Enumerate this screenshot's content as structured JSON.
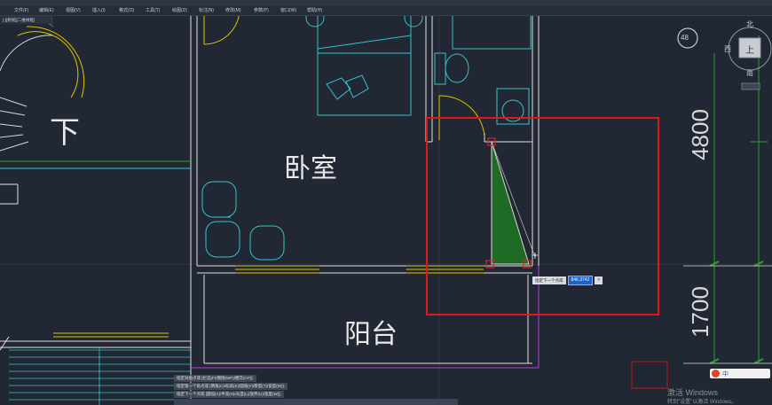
{
  "menu": [
    "文件(F)",
    "编辑(E)",
    "视图(V)",
    "插入(I)",
    "格式(O)",
    "工具(T)",
    "绘图(D)",
    "标注(N)",
    "修改(M)",
    "参数(P)",
    "窗口(W)",
    "帮助(H)"
  ],
  "tab": "[-][俯视][二维线框]",
  "rooms": {
    "stairs": "下",
    "bedroom": "卧室",
    "balcony": "阳台"
  },
  "dimensions": {
    "upper": "4800",
    "lower": "1700"
  },
  "compass": {
    "scale": "48",
    "north": "北",
    "west": "西",
    "south": "南",
    "center": "上"
  },
  "command_history": [
    "指定对角点或 [栏选(F)/圈围(WP)/圈交(CP)]:",
    "指定第一个角点或 [倒角(C)/标高(E)/圆角(F)/厚度(T)/宽度(W)]:",
    "指定下一个点或 [圆弧(A)/半宽(H)/长度(L)/放弃(U)/宽度(W)]:"
  ],
  "dynamic_input": {
    "label": "指定下一个点或",
    "value": "846.3742"
  },
  "watermark": {
    "title": "激活 Windows",
    "subtitle": "转到\"设置\"以激活 Windows。"
  },
  "ime_text": "中"
}
